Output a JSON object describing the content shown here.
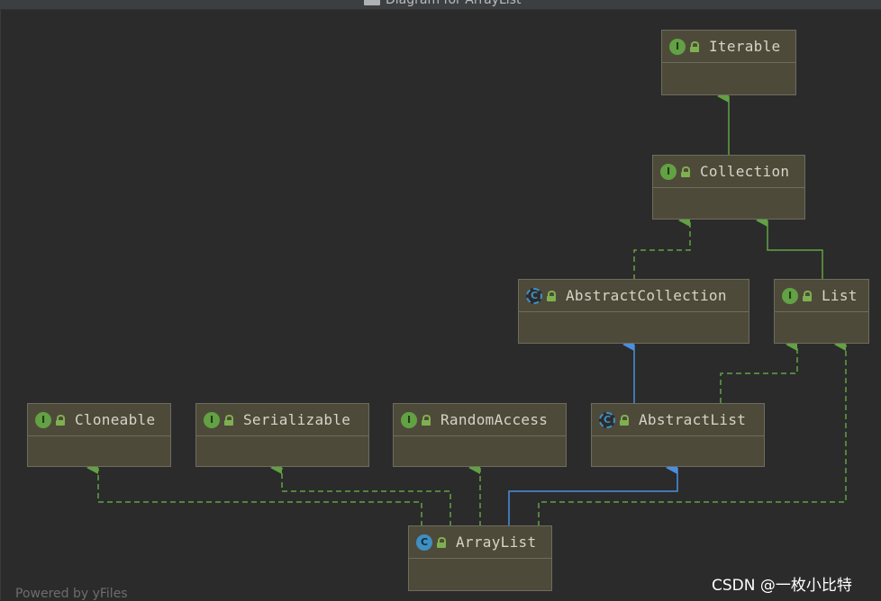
{
  "window": {
    "title": "Diagram for ArrayList"
  },
  "nodes": [
    {
      "id": "iterable",
      "kind": "interface",
      "badge": "I",
      "name": "Iterable"
    },
    {
      "id": "collection",
      "kind": "interface",
      "badge": "I",
      "name": "Collection"
    },
    {
      "id": "abstractcollection",
      "kind": "abstract-class",
      "badge": "C",
      "name": "AbstractCollection"
    },
    {
      "id": "list",
      "kind": "interface",
      "badge": "I",
      "name": "List"
    },
    {
      "id": "cloneable",
      "kind": "interface",
      "badge": "I",
      "name": "Cloneable"
    },
    {
      "id": "serializable",
      "kind": "interface",
      "badge": "I",
      "name": "Serializable"
    },
    {
      "id": "randomaccess",
      "kind": "interface",
      "badge": "I",
      "name": "RandomAccess"
    },
    {
      "id": "abstractlist",
      "kind": "abstract-class",
      "badge": "C",
      "name": "AbstractList"
    },
    {
      "id": "arraylist",
      "kind": "class",
      "badge": "C",
      "name": "ArrayList"
    }
  ],
  "edges": [
    {
      "from": "collection",
      "to": "iterable",
      "type": "extends"
    },
    {
      "from": "abstractcollection",
      "to": "collection",
      "type": "implements"
    },
    {
      "from": "list",
      "to": "collection",
      "type": "extends"
    },
    {
      "from": "abstractlist",
      "to": "abstractcollection",
      "type": "extends-class"
    },
    {
      "from": "abstractlist",
      "to": "list",
      "type": "implements"
    },
    {
      "from": "arraylist",
      "to": "cloneable",
      "type": "implements"
    },
    {
      "from": "arraylist",
      "to": "serializable",
      "type": "implements"
    },
    {
      "from": "arraylist",
      "to": "randomaccess",
      "type": "implements"
    },
    {
      "from": "arraylist",
      "to": "abstractlist",
      "type": "extends-class"
    },
    {
      "from": "arraylist",
      "to": "list",
      "type": "implements"
    }
  ],
  "colors": {
    "background": "#2b2b2b",
    "node_fill": "#4e4a3a",
    "interface_edge": "#62a144",
    "class_edge": "#4a8fdf",
    "interface_badge": "#62a144",
    "class_badge": "#3f8fc1"
  },
  "icons": {
    "interface": "interface-i-icon",
    "class": "class-c-icon",
    "abstract-class": "abstract-class-c-icon",
    "visibility": "public-lock-icon"
  },
  "footer": {
    "powered_by": "Powered by yFiles",
    "watermark": "CSDN @一枚小比特"
  }
}
